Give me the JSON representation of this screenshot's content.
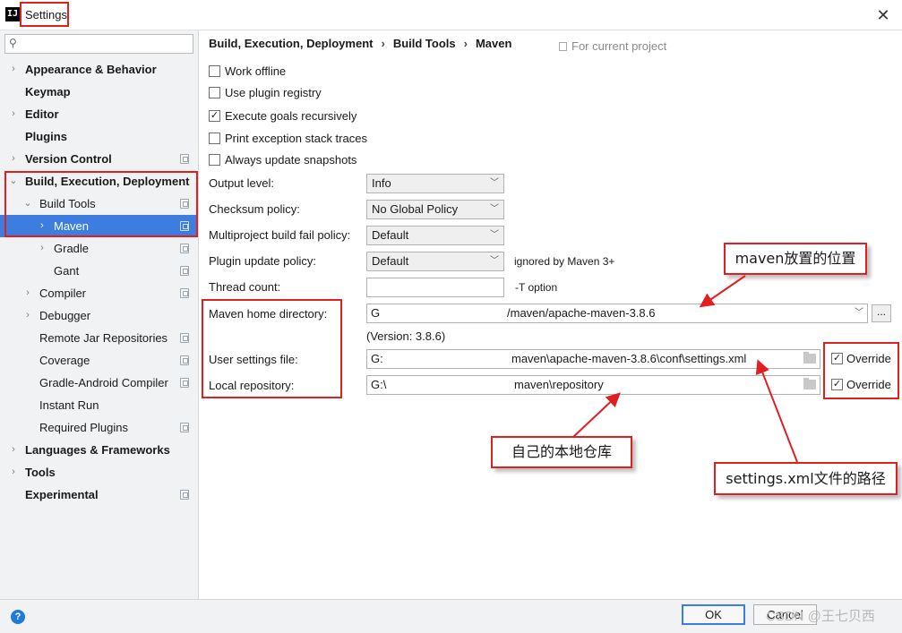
{
  "window": {
    "title": "Settings",
    "close_glyph": "✕",
    "app_icon_text": "IJ"
  },
  "sidebar": {
    "search_placeholder": "",
    "items": [
      {
        "label": "Appearance & Behavior",
        "arrow": "›"
      },
      {
        "label": "Keymap",
        "arrow": ""
      },
      {
        "label": "Editor",
        "arrow": "›"
      },
      {
        "label": "Plugins",
        "arrow": ""
      },
      {
        "label": "Version Control",
        "arrow": "›"
      },
      {
        "label": "Build, Execution, Deployment",
        "arrow": "⌄"
      },
      {
        "label": "Build Tools",
        "arrow": "⌄"
      },
      {
        "label": "Maven",
        "arrow": "›"
      },
      {
        "label": "Gradle",
        "arrow": "›"
      },
      {
        "label": "Gant",
        "arrow": ""
      },
      {
        "label": "Compiler",
        "arrow": "›"
      },
      {
        "label": "Debugger",
        "arrow": "›"
      },
      {
        "label": "Remote Jar Repositories",
        "arrow": ""
      },
      {
        "label": "Coverage",
        "arrow": ""
      },
      {
        "label": "Gradle-Android Compiler",
        "arrow": ""
      },
      {
        "label": "Instant Run",
        "arrow": ""
      },
      {
        "label": "Required Plugins",
        "arrow": ""
      },
      {
        "label": "Languages & Frameworks",
        "arrow": "›"
      },
      {
        "label": "Tools",
        "arrow": "›"
      },
      {
        "label": "Experimental",
        "arrow": ""
      }
    ]
  },
  "breadcrumb": {
    "parts": [
      "Build, Execution, Deployment",
      "Build Tools",
      "Maven"
    ],
    "separator": "›",
    "project_note": "For current project"
  },
  "options": {
    "work_offline": {
      "label": "Work offline",
      "checked": false
    },
    "use_plugin_registry": {
      "label": "Use plugin registry",
      "checked": false
    },
    "execute_goals_recursively": {
      "label": "Execute goals recursively",
      "checked": true
    },
    "print_exception_stack_traces": {
      "label": "Print exception stack traces",
      "checked": false
    },
    "always_update_snapshots": {
      "label": "Always update snapshots",
      "checked": false
    }
  },
  "fields": {
    "output_level": {
      "label": "Output level:",
      "value": "Info"
    },
    "checksum_policy": {
      "label": "Checksum policy:",
      "value": "No Global Policy"
    },
    "multiproject_fail_policy": {
      "label": "Multiproject build fail policy:",
      "value": "Default"
    },
    "plugin_update_policy": {
      "label": "Plugin update policy:",
      "value": "Default",
      "hint": "ignored by Maven 3+"
    },
    "thread_count": {
      "label": "Thread count:",
      "value": "",
      "hint": "-T option"
    },
    "maven_home": {
      "label": "Maven home directory:",
      "prefix": "G",
      "suffix": "/maven/apache-maven-3.8.6",
      "browse": "..."
    },
    "version": "(Version: 3.8.6)",
    "user_settings": {
      "label": "User settings file:",
      "prefix": "G:",
      "suffix": "maven\\apache-maven-3.8.6\\conf\\settings.xml",
      "override_label": "Override",
      "override_checked": true
    },
    "local_repository": {
      "label": "Local repository:",
      "prefix": "G:\\",
      "suffix": "maven\\repository",
      "override_label": "Override",
      "override_checked": true
    }
  },
  "annotations": {
    "maven_location": "maven放置的位置",
    "local_repo": "自己的本地仓库",
    "settings_path": "settings.xml文件的路径",
    "color": "#e02020"
  },
  "footer": {
    "help_glyph": "?",
    "ok_label": "OK",
    "cancel_label": "Cancel",
    "watermark": "CSDN @王七贝西"
  },
  "colors": {
    "selection": "#3d7ddf",
    "sidebar_bg": "#f0f2f4"
  }
}
